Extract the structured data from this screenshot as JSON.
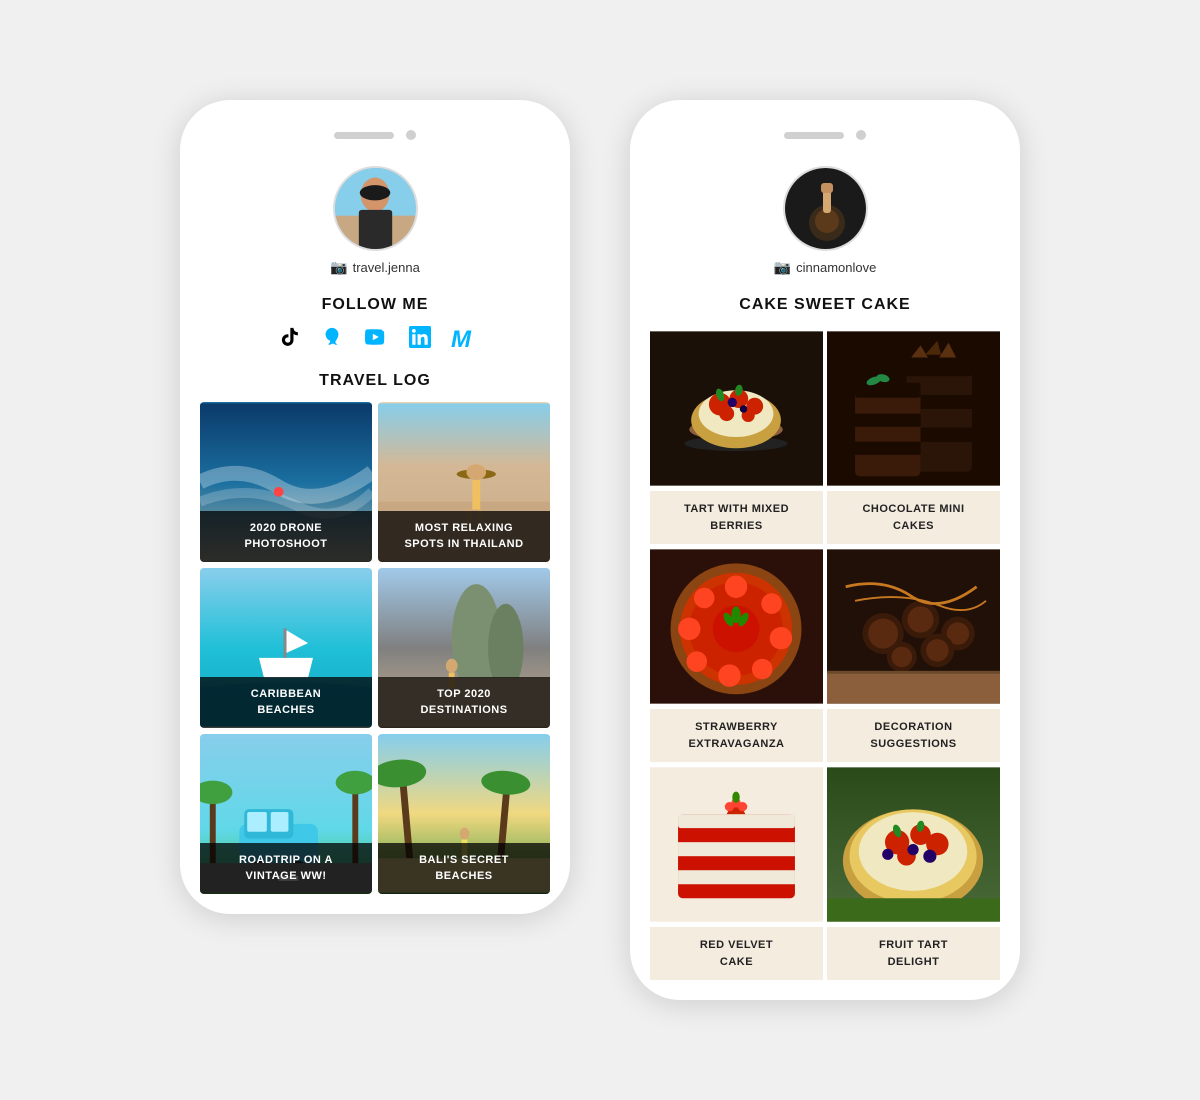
{
  "phone1": {
    "username": "travel.jenna",
    "follow_label": "FOLLOW ME",
    "travel_log_label": "TRAVEL LOG",
    "social_icons": [
      "TikTok",
      "Snapchat",
      "YouTube",
      "LinkedIn",
      "Medium"
    ],
    "grid_items": [
      {
        "title": "2020 DRONE\nPHOTOSHOOT",
        "img": "drone"
      },
      {
        "title": "MOST RELAXING\nSPOTS IN THAILAND",
        "img": "thailand"
      },
      {
        "title": "CARIBBEAN\nBEACHES",
        "img": "caribbean"
      },
      {
        "title": "TOP 2020\nDESTINATIONS",
        "img": "destinations"
      },
      {
        "title": "ROADTRIP ON A\nVINTAGE WW!",
        "img": "roadtrip"
      },
      {
        "title": "BALI'S SECRET\nBEACHES",
        "img": "bali"
      }
    ]
  },
  "phone2": {
    "username": "cinnamonlove",
    "blog_title": "CAKE SWEET CAKE",
    "food_items": [
      {
        "title": "TART WITH MIXED\nBERRIES",
        "img": "tart"
      },
      {
        "title": "CHOCOLATE MINI\nCAKES",
        "img": "choco-cakes"
      },
      {
        "title": "STRAWBERRY\nEXTRAVAGANZA",
        "img": "strawberry"
      },
      {
        "title": "DECORATION\nSUGGESTIONS",
        "img": "decoration"
      },
      {
        "title": "RED VELVET\nCAKE",
        "img": "red-velvet"
      },
      {
        "title": "FRUIT TART\nDELIGHT",
        "img": "fruit-tart"
      }
    ]
  }
}
